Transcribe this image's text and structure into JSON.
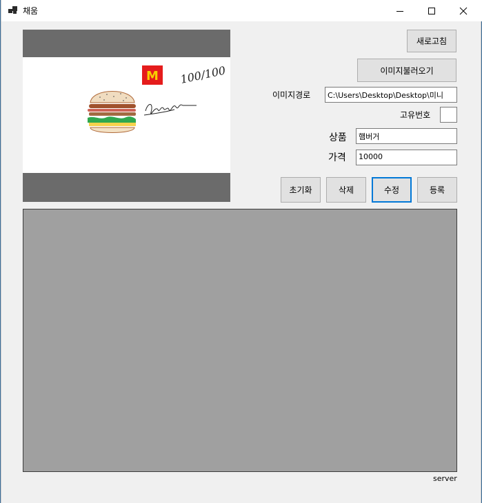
{
  "window": {
    "title": "채움"
  },
  "buttons": {
    "refresh": "새로고침",
    "load_image": "이미지불러오기",
    "reset": "초기화",
    "delete": "삭제",
    "edit": "수정",
    "register": "등록"
  },
  "fields": {
    "image_path_label": "이미지경로",
    "image_path_value": "C:\\Users\\Desktop\\Desktop\\미니",
    "unique_id_label": "고유번호",
    "unique_id_value": "",
    "product_label": "상품",
    "product_value": "햄버거",
    "price_label": "가격",
    "price_value": "10000"
  },
  "status": {
    "text": "server"
  },
  "picture": {
    "handwriting_1": "100/100",
    "logo_letter": "M"
  },
  "colors": {
    "focus": "#0078d7",
    "grid_bg": "#a0a0a0",
    "picture_frame": "#6b6b6b"
  }
}
